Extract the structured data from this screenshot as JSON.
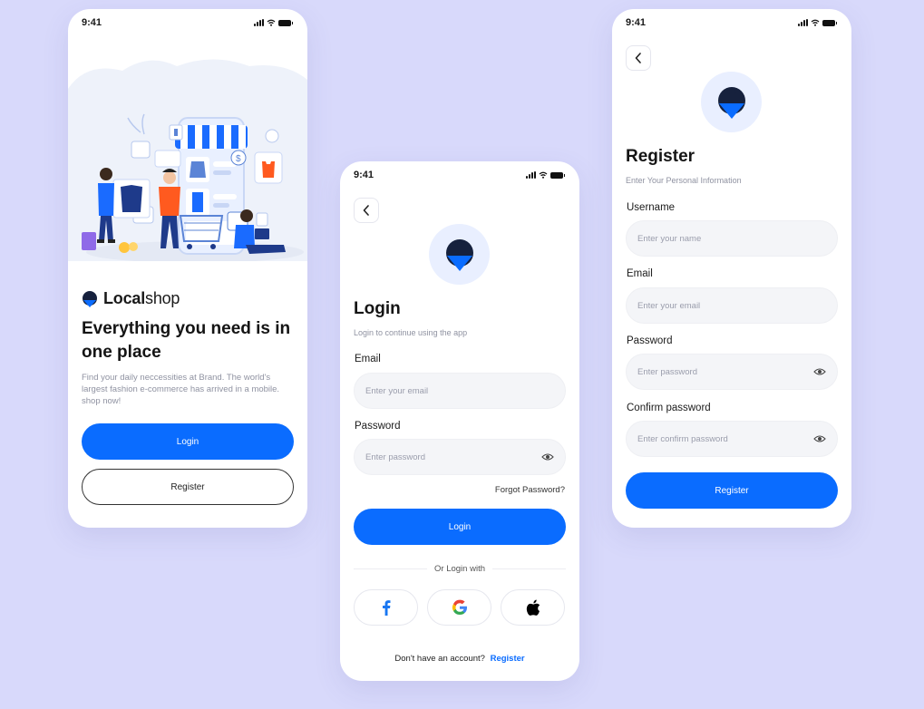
{
  "status_time": "9:41",
  "colors": {
    "background": "#d8d9fb",
    "primary": "#0a6cff",
    "input_bg": "#f4f5f8"
  },
  "welcome": {
    "brand_bold": "Local",
    "brand_rest": "shop",
    "headline": "Everything you need is in one place",
    "description": "Find your daily neccessities at Brand. The world's largest fashion e-commerce has arrived in a mobile. shop now!",
    "login_label": "Login",
    "register_label": "Register"
  },
  "login": {
    "title": "Login",
    "subtitle": "Login to continue using the app",
    "email_label": "Email",
    "email_placeholder": "Enter your email",
    "password_label": "Password",
    "password_placeholder": "Enter password",
    "forgot_label": "Forgot Password?",
    "login_label": "Login",
    "divider_text": "Or Login with",
    "social": [
      "facebook-icon",
      "google-icon",
      "apple-icon"
    ],
    "no_account_text": "Don't have an account?",
    "register_link": "Register"
  },
  "register": {
    "title": "Register",
    "subtitle": "Enter Your Personal Information",
    "username_label": "Username",
    "username_placeholder": "Enter your name",
    "email_label": "Email",
    "email_placeholder": "Enter your email",
    "password_label": "Password",
    "password_placeholder": "Enter password",
    "confirm_label": "Confirm password",
    "confirm_placeholder": "Enter confirm password",
    "register_label": "Register"
  }
}
